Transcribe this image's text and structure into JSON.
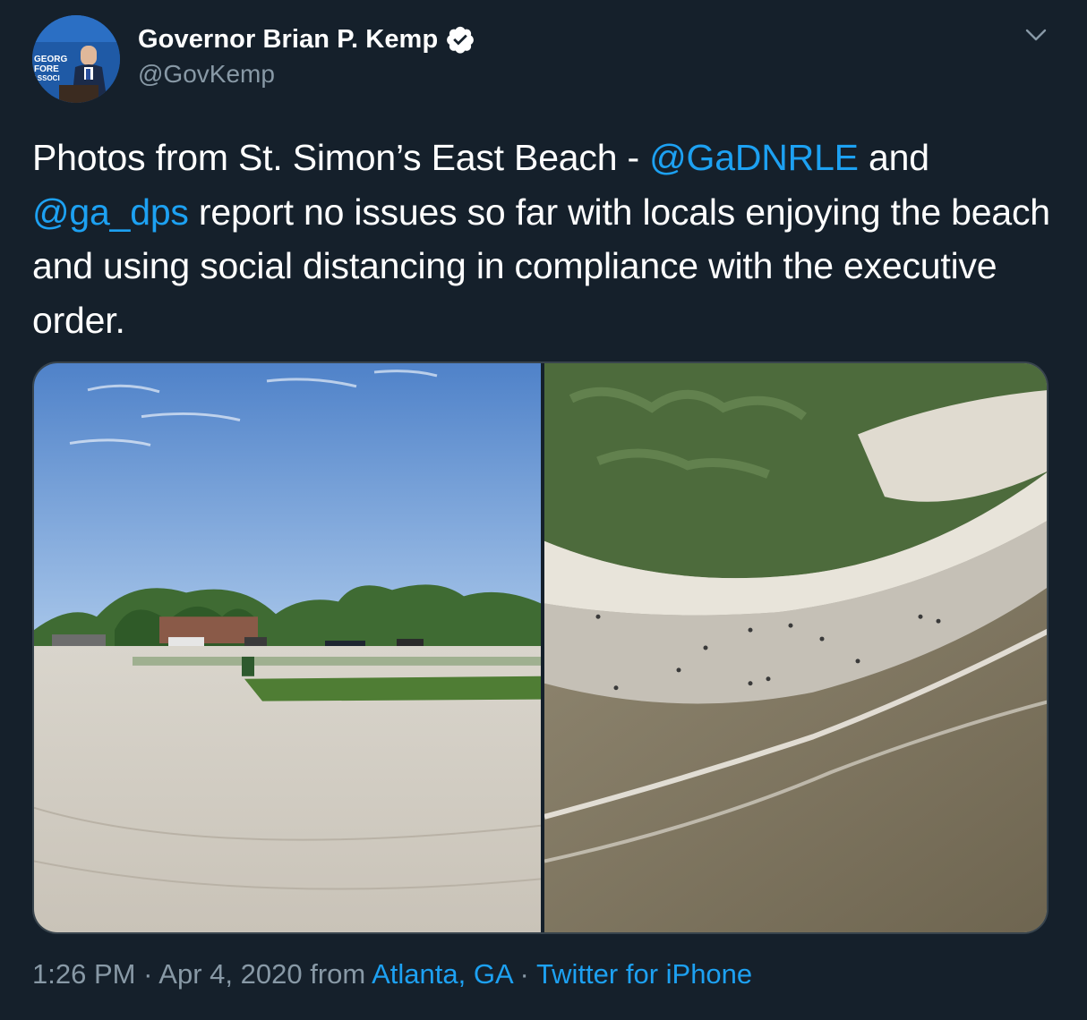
{
  "author": {
    "display_name": "Governor Brian P. Kemp",
    "handle": "@GovKemp",
    "verified_icon": "verified-badge-icon",
    "avatar_backdrop_text": [
      "GEORG",
      "FORE",
      "ASSOCI"
    ]
  },
  "tweet": {
    "text_1": "Photos from St. Simon’s East Beach - ",
    "mention_1": "@GaDNRLE",
    "text_2": " and ",
    "mention_2": "@ga_dps",
    "text_3": " report no issues so far with locals enjoying the beach and using social distancing in compliance with the executive order."
  },
  "media": {
    "photos": [
      {
        "subject": "parking lot and sandy area at the beach"
      },
      {
        "subject": "aerial view of beach and dunes"
      }
    ]
  },
  "footer": {
    "time": "1:26 PM",
    "separator": " · ",
    "date": "Apr 4, 2020",
    "from_label": " from ",
    "location": "Atlanta, GA",
    "separator_2": " · ",
    "source": "Twitter for iPhone"
  },
  "colors": {
    "background": "#15202b",
    "link": "#1da1f2",
    "secondary_text": "#8899a6",
    "border": "#38444d"
  }
}
